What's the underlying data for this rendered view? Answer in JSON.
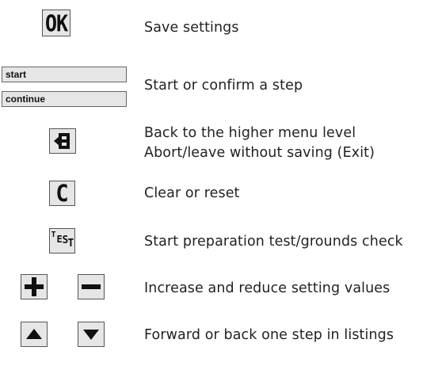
{
  "items": [
    {
      "key": "OK",
      "description": [
        "Save settings"
      ]
    },
    {
      "keys": [
        "start",
        "continue"
      ],
      "description": [
        "Start or confirm a step"
      ]
    },
    {
      "key_icon": "back-exit-icon",
      "description": [
        "Back to the higher menu level",
        "Abort/leave without saving (Exit)"
      ]
    },
    {
      "key": "C",
      "description": [
        "Clear or reset"
      ]
    },
    {
      "key_letters": [
        "T",
        "E",
        "S",
        "T"
      ],
      "description": [
        "Start preparation test/grounds check"
      ]
    },
    {
      "key_icons": [
        "plus-icon",
        "minus-icon"
      ],
      "description": [
        "Increase and reduce setting values"
      ]
    },
    {
      "key_icons": [
        "arrow-up-icon",
        "arrow-down-icon"
      ],
      "description": [
        "Forward or back one step in listings"
      ]
    }
  ]
}
